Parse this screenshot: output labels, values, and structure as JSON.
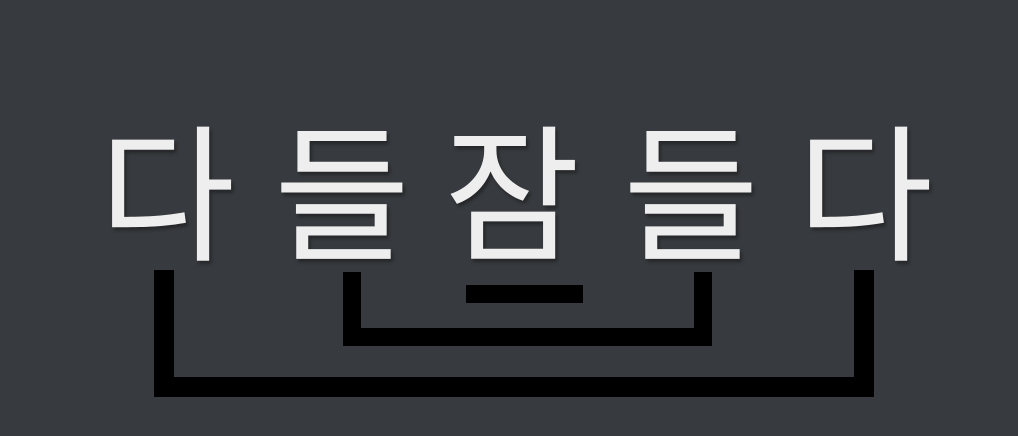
{
  "palindrome": {
    "syllables": [
      "다",
      "들",
      "잠",
      "들",
      "다"
    ]
  },
  "colors": {
    "background": "#373a3e",
    "text": "#eeeeee",
    "bracket": "#000000"
  }
}
